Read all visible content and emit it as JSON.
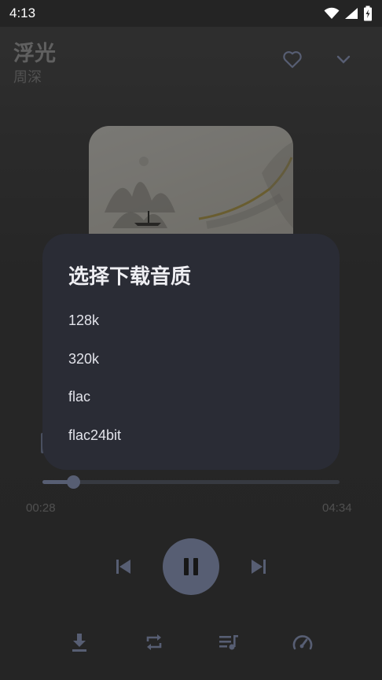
{
  "status_bar": {
    "time": "4:13",
    "icons": [
      "wifi-icon",
      "signal-icon",
      "battery-charging-icon"
    ]
  },
  "player": {
    "title": "浮光",
    "artist": "周深",
    "current_time": "00:28",
    "total_time": "04:34",
    "progress": 0.104,
    "playing": true,
    "accent_color": "#a8b4dc",
    "top_icons": [
      "heart-icon",
      "chevron-down-icon"
    ],
    "transport_icons": [
      "skip-previous-icon",
      "pause-icon",
      "skip-next-icon"
    ],
    "bottom_icons": [
      "download-icon",
      "repeat-icon",
      "playlist-icon",
      "speed-icon"
    ]
  },
  "dialog": {
    "title": "选择下载音质",
    "options": [
      {
        "label": "128k"
      },
      {
        "label": "320k"
      },
      {
        "label": "flac"
      },
      {
        "label": "flac24bit"
      }
    ]
  }
}
